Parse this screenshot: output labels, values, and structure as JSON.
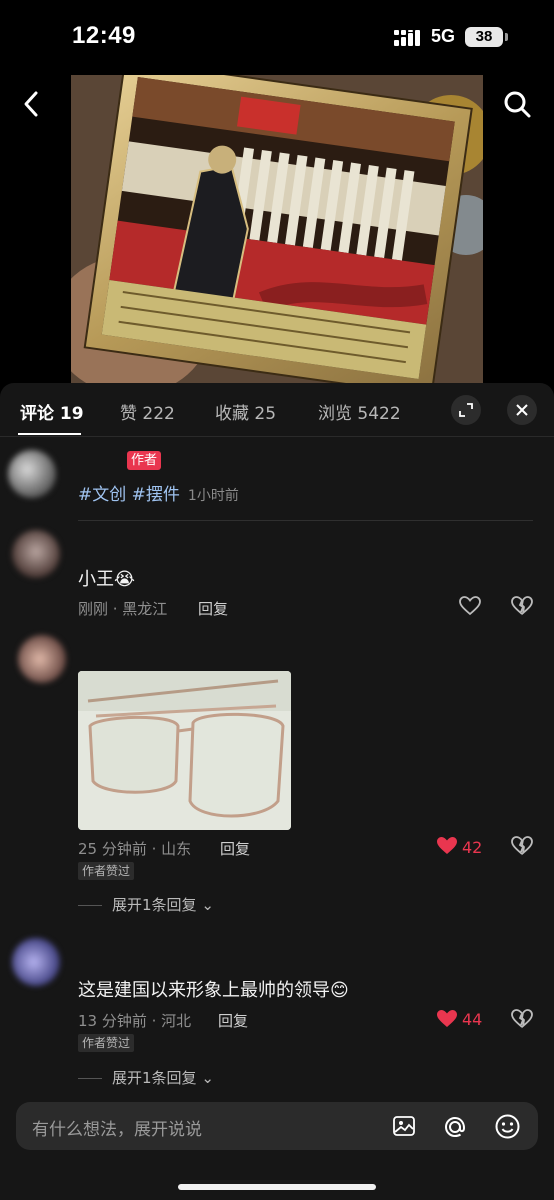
{
  "status_bar": {
    "time": "12:49",
    "network": "5G",
    "battery": "38"
  },
  "post": {
    "image_icon": "enamel-plaque-photo"
  },
  "tabs": [
    {
      "label": "评论 19"
    },
    {
      "label": "赞 222"
    },
    {
      "label": "收藏 25"
    },
    {
      "label": "浏览 5422"
    }
  ],
  "author_post": {
    "badge": "作者",
    "topics": "#文创 #摆件",
    "time": "1小时前"
  },
  "comments": [
    {
      "text": "小王😭",
      "meta": "刚刚 · 黑龙江",
      "reply": "回复"
    },
    {
      "meta": "25 分钟前 · 山东",
      "reply": "回复",
      "likes": "42",
      "liked_badge": "作者赞过",
      "expand": "展开1条回复"
    },
    {
      "text": "这是建国以来形象上最帅的领导😊",
      "meta": "13 分钟前 · 河北",
      "reply": "回复",
      "likes": "44",
      "liked_badge": "作者赞过",
      "expand": "展开1条回复"
    }
  ],
  "input": {
    "placeholder": "有什么想法，展开说说"
  },
  "colors": {
    "accent": "#e9364f",
    "topic": "#9fc3f0",
    "sheet": "#161616"
  }
}
